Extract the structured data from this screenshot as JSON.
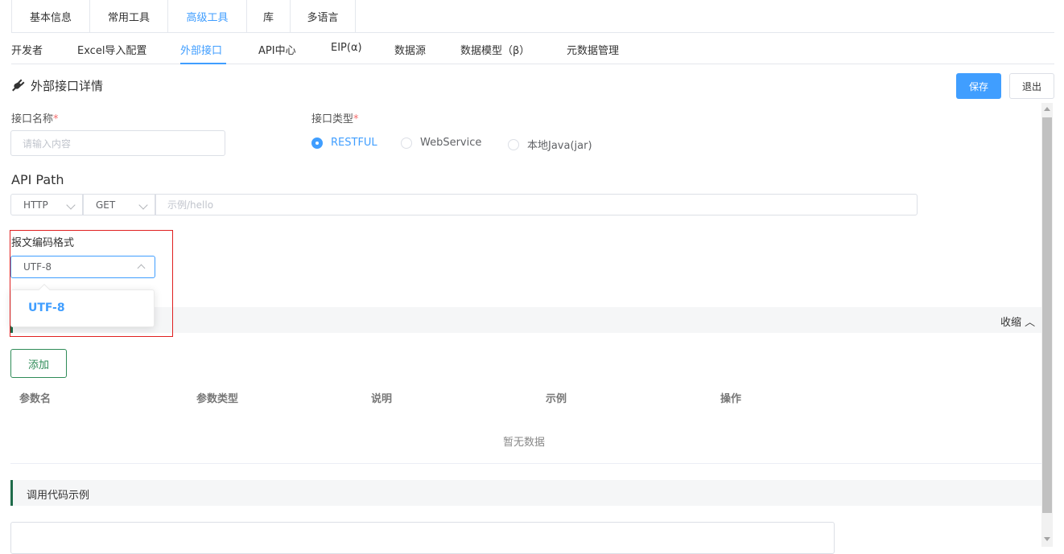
{
  "top_tabs": [
    "基本信息",
    "常用工具",
    "高级工具",
    "库",
    "多语言"
  ],
  "sub_tabs": [
    "开发者",
    "Excel导入配置",
    "外部接口",
    "API中心",
    "EIP(α)",
    "数据源",
    "数据模型（β）",
    "元数据管理"
  ],
  "header": {
    "title": "外部接口详情",
    "save": "保存",
    "exit": "退出"
  },
  "form": {
    "name_label": "接口名称",
    "name_placeholder": "请输入内容",
    "type_label": "接口类型",
    "type_options": [
      "RESTFUL",
      "WebService",
      "本地Java(jar)"
    ],
    "type_selected": "RESTFUL",
    "required_mark": "*",
    "api_path_label": "API Path",
    "protocol": "HTTP",
    "method": "GET",
    "path_placeholder": "示例/hello",
    "encoding_label": "报文编码格式",
    "encoding_value": "UTF-8",
    "encoding_options": [
      "UTF-8"
    ]
  },
  "params_section": {
    "collapse": "收缩",
    "add": "添加",
    "columns": [
      "参数名",
      "参数类型",
      "说明",
      "示例",
      "操作"
    ],
    "empty": "暂无数据"
  },
  "code_section": {
    "title": "调用代码示例"
  },
  "colors": {
    "primary": "#409eff",
    "accent_green": "#1f6b4a",
    "required": "#f56c6c",
    "highlight": "#e02020"
  }
}
